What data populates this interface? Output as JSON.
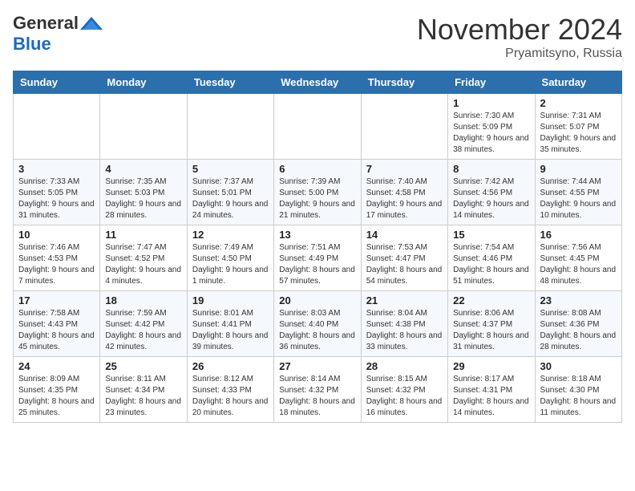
{
  "header": {
    "logo_general": "General",
    "logo_blue": "Blue",
    "month_title": "November 2024",
    "location": "Pryamitsyno, Russia"
  },
  "weekdays": [
    "Sunday",
    "Monday",
    "Tuesday",
    "Wednesday",
    "Thursday",
    "Friday",
    "Saturday"
  ],
  "weeks": [
    [
      {
        "day": "",
        "info": ""
      },
      {
        "day": "",
        "info": ""
      },
      {
        "day": "",
        "info": ""
      },
      {
        "day": "",
        "info": ""
      },
      {
        "day": "",
        "info": ""
      },
      {
        "day": "1",
        "info": "Sunrise: 7:30 AM\nSunset: 5:09 PM\nDaylight: 9 hours and 38 minutes."
      },
      {
        "day": "2",
        "info": "Sunrise: 7:31 AM\nSunset: 5:07 PM\nDaylight: 9 hours and 35 minutes."
      }
    ],
    [
      {
        "day": "3",
        "info": "Sunrise: 7:33 AM\nSunset: 5:05 PM\nDaylight: 9 hours and 31 minutes."
      },
      {
        "day": "4",
        "info": "Sunrise: 7:35 AM\nSunset: 5:03 PM\nDaylight: 9 hours and 28 minutes."
      },
      {
        "day": "5",
        "info": "Sunrise: 7:37 AM\nSunset: 5:01 PM\nDaylight: 9 hours and 24 minutes."
      },
      {
        "day": "6",
        "info": "Sunrise: 7:39 AM\nSunset: 5:00 PM\nDaylight: 9 hours and 21 minutes."
      },
      {
        "day": "7",
        "info": "Sunrise: 7:40 AM\nSunset: 4:58 PM\nDaylight: 9 hours and 17 minutes."
      },
      {
        "day": "8",
        "info": "Sunrise: 7:42 AM\nSunset: 4:56 PM\nDaylight: 9 hours and 14 minutes."
      },
      {
        "day": "9",
        "info": "Sunrise: 7:44 AM\nSunset: 4:55 PM\nDaylight: 9 hours and 10 minutes."
      }
    ],
    [
      {
        "day": "10",
        "info": "Sunrise: 7:46 AM\nSunset: 4:53 PM\nDaylight: 9 hours and 7 minutes."
      },
      {
        "day": "11",
        "info": "Sunrise: 7:47 AM\nSunset: 4:52 PM\nDaylight: 9 hours and 4 minutes."
      },
      {
        "day": "12",
        "info": "Sunrise: 7:49 AM\nSunset: 4:50 PM\nDaylight: 9 hours and 1 minute."
      },
      {
        "day": "13",
        "info": "Sunrise: 7:51 AM\nSunset: 4:49 PM\nDaylight: 8 hours and 57 minutes."
      },
      {
        "day": "14",
        "info": "Sunrise: 7:53 AM\nSunset: 4:47 PM\nDaylight: 8 hours and 54 minutes."
      },
      {
        "day": "15",
        "info": "Sunrise: 7:54 AM\nSunset: 4:46 PM\nDaylight: 8 hours and 51 minutes."
      },
      {
        "day": "16",
        "info": "Sunrise: 7:56 AM\nSunset: 4:45 PM\nDaylight: 8 hours and 48 minutes."
      }
    ],
    [
      {
        "day": "17",
        "info": "Sunrise: 7:58 AM\nSunset: 4:43 PM\nDaylight: 8 hours and 45 minutes."
      },
      {
        "day": "18",
        "info": "Sunrise: 7:59 AM\nSunset: 4:42 PM\nDaylight: 8 hours and 42 minutes."
      },
      {
        "day": "19",
        "info": "Sunrise: 8:01 AM\nSunset: 4:41 PM\nDaylight: 8 hours and 39 minutes."
      },
      {
        "day": "20",
        "info": "Sunrise: 8:03 AM\nSunset: 4:40 PM\nDaylight: 8 hours and 36 minutes."
      },
      {
        "day": "21",
        "info": "Sunrise: 8:04 AM\nSunset: 4:38 PM\nDaylight: 8 hours and 33 minutes."
      },
      {
        "day": "22",
        "info": "Sunrise: 8:06 AM\nSunset: 4:37 PM\nDaylight: 8 hours and 31 minutes."
      },
      {
        "day": "23",
        "info": "Sunrise: 8:08 AM\nSunset: 4:36 PM\nDaylight: 8 hours and 28 minutes."
      }
    ],
    [
      {
        "day": "24",
        "info": "Sunrise: 8:09 AM\nSunset: 4:35 PM\nDaylight: 8 hours and 25 minutes."
      },
      {
        "day": "25",
        "info": "Sunrise: 8:11 AM\nSunset: 4:34 PM\nDaylight: 8 hours and 23 minutes."
      },
      {
        "day": "26",
        "info": "Sunrise: 8:12 AM\nSunset: 4:33 PM\nDaylight: 8 hours and 20 minutes."
      },
      {
        "day": "27",
        "info": "Sunrise: 8:14 AM\nSunset: 4:32 PM\nDaylight: 8 hours and 18 minutes."
      },
      {
        "day": "28",
        "info": "Sunrise: 8:15 AM\nSunset: 4:32 PM\nDaylight: 8 hours and 16 minutes."
      },
      {
        "day": "29",
        "info": "Sunrise: 8:17 AM\nSunset: 4:31 PM\nDaylight: 8 hours and 14 minutes."
      },
      {
        "day": "30",
        "info": "Sunrise: 8:18 AM\nSunset: 4:30 PM\nDaylight: 8 hours and 11 minutes."
      }
    ]
  ]
}
